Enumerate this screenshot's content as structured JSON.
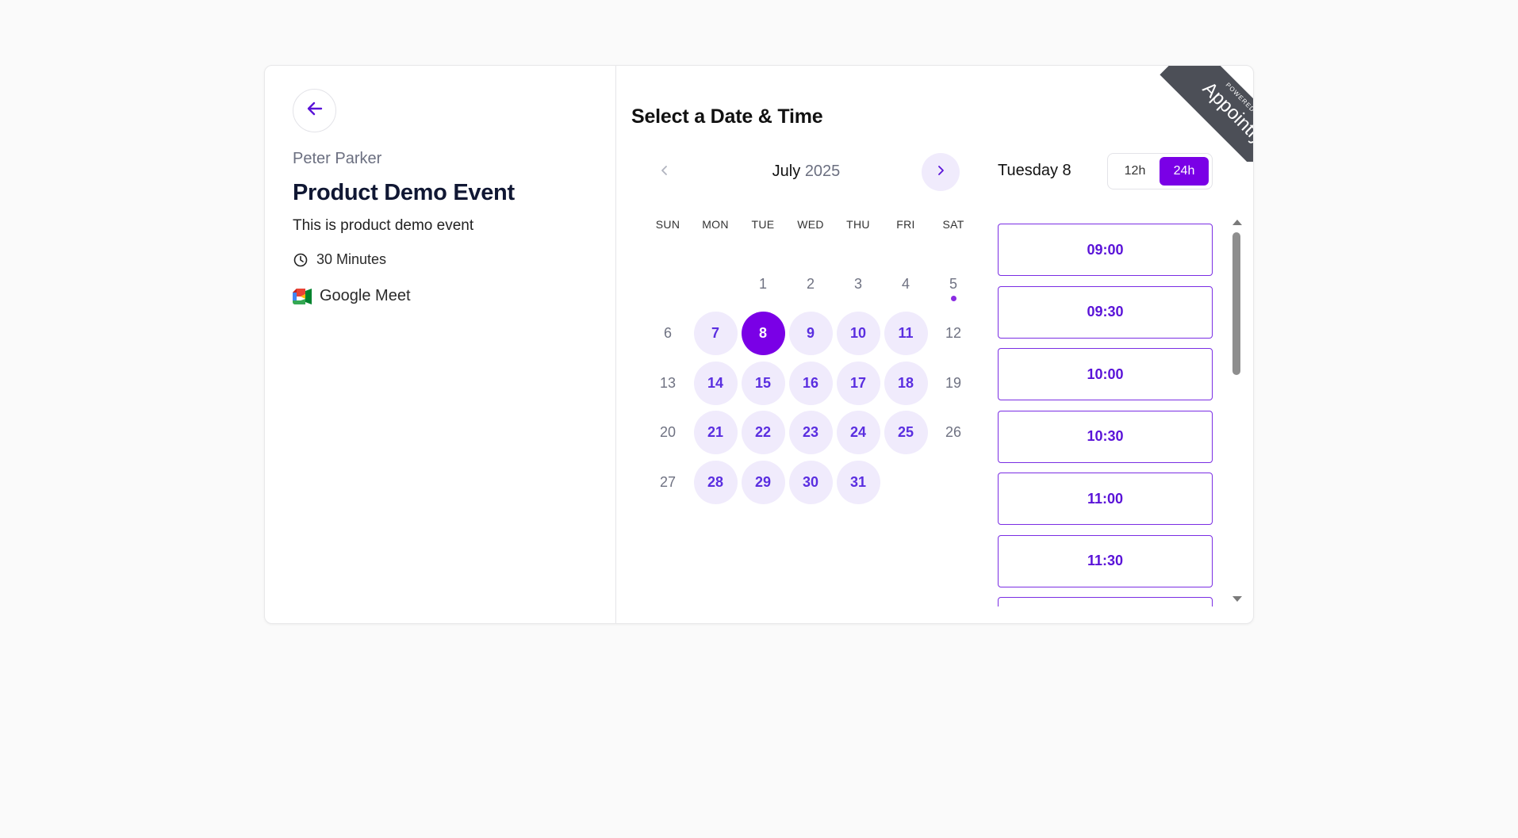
{
  "left": {
    "host": "Peter Parker",
    "title": "Product Demo Event",
    "description": "This is product demo event",
    "duration": "30 Minutes",
    "location": "Google Meet"
  },
  "right": {
    "section_title": "Select a Date & Time",
    "month": "July",
    "year": "2025",
    "weekdays": [
      "SUN",
      "MON",
      "TUE",
      "WED",
      "THU",
      "FRI",
      "SAT"
    ],
    "selected_date_label": "Tuesday 8",
    "toggle": {
      "h12": "12h",
      "h24": "24h",
      "active": "24h"
    },
    "slots": [
      "09:00",
      "09:30",
      "10:00",
      "10:30",
      "11:00",
      "11:30"
    ]
  },
  "calendar": {
    "first_weekday_index": 2,
    "days_in_month": 31,
    "available_days": [
      7,
      8,
      9,
      10,
      11,
      14,
      15,
      16,
      17,
      18,
      21,
      22,
      23,
      24,
      25,
      28,
      29,
      30,
      31
    ],
    "selected_day": 8,
    "today_dot_day": 5
  },
  "ribbon": {
    "small": "POWERED BY",
    "brand": "Appointly"
  },
  "colors": {
    "accent": "#7a00e6",
    "available_bg": "#f0ebfc",
    "available_text": "#5a2ee0",
    "ribbon": "#4c4f57"
  }
}
